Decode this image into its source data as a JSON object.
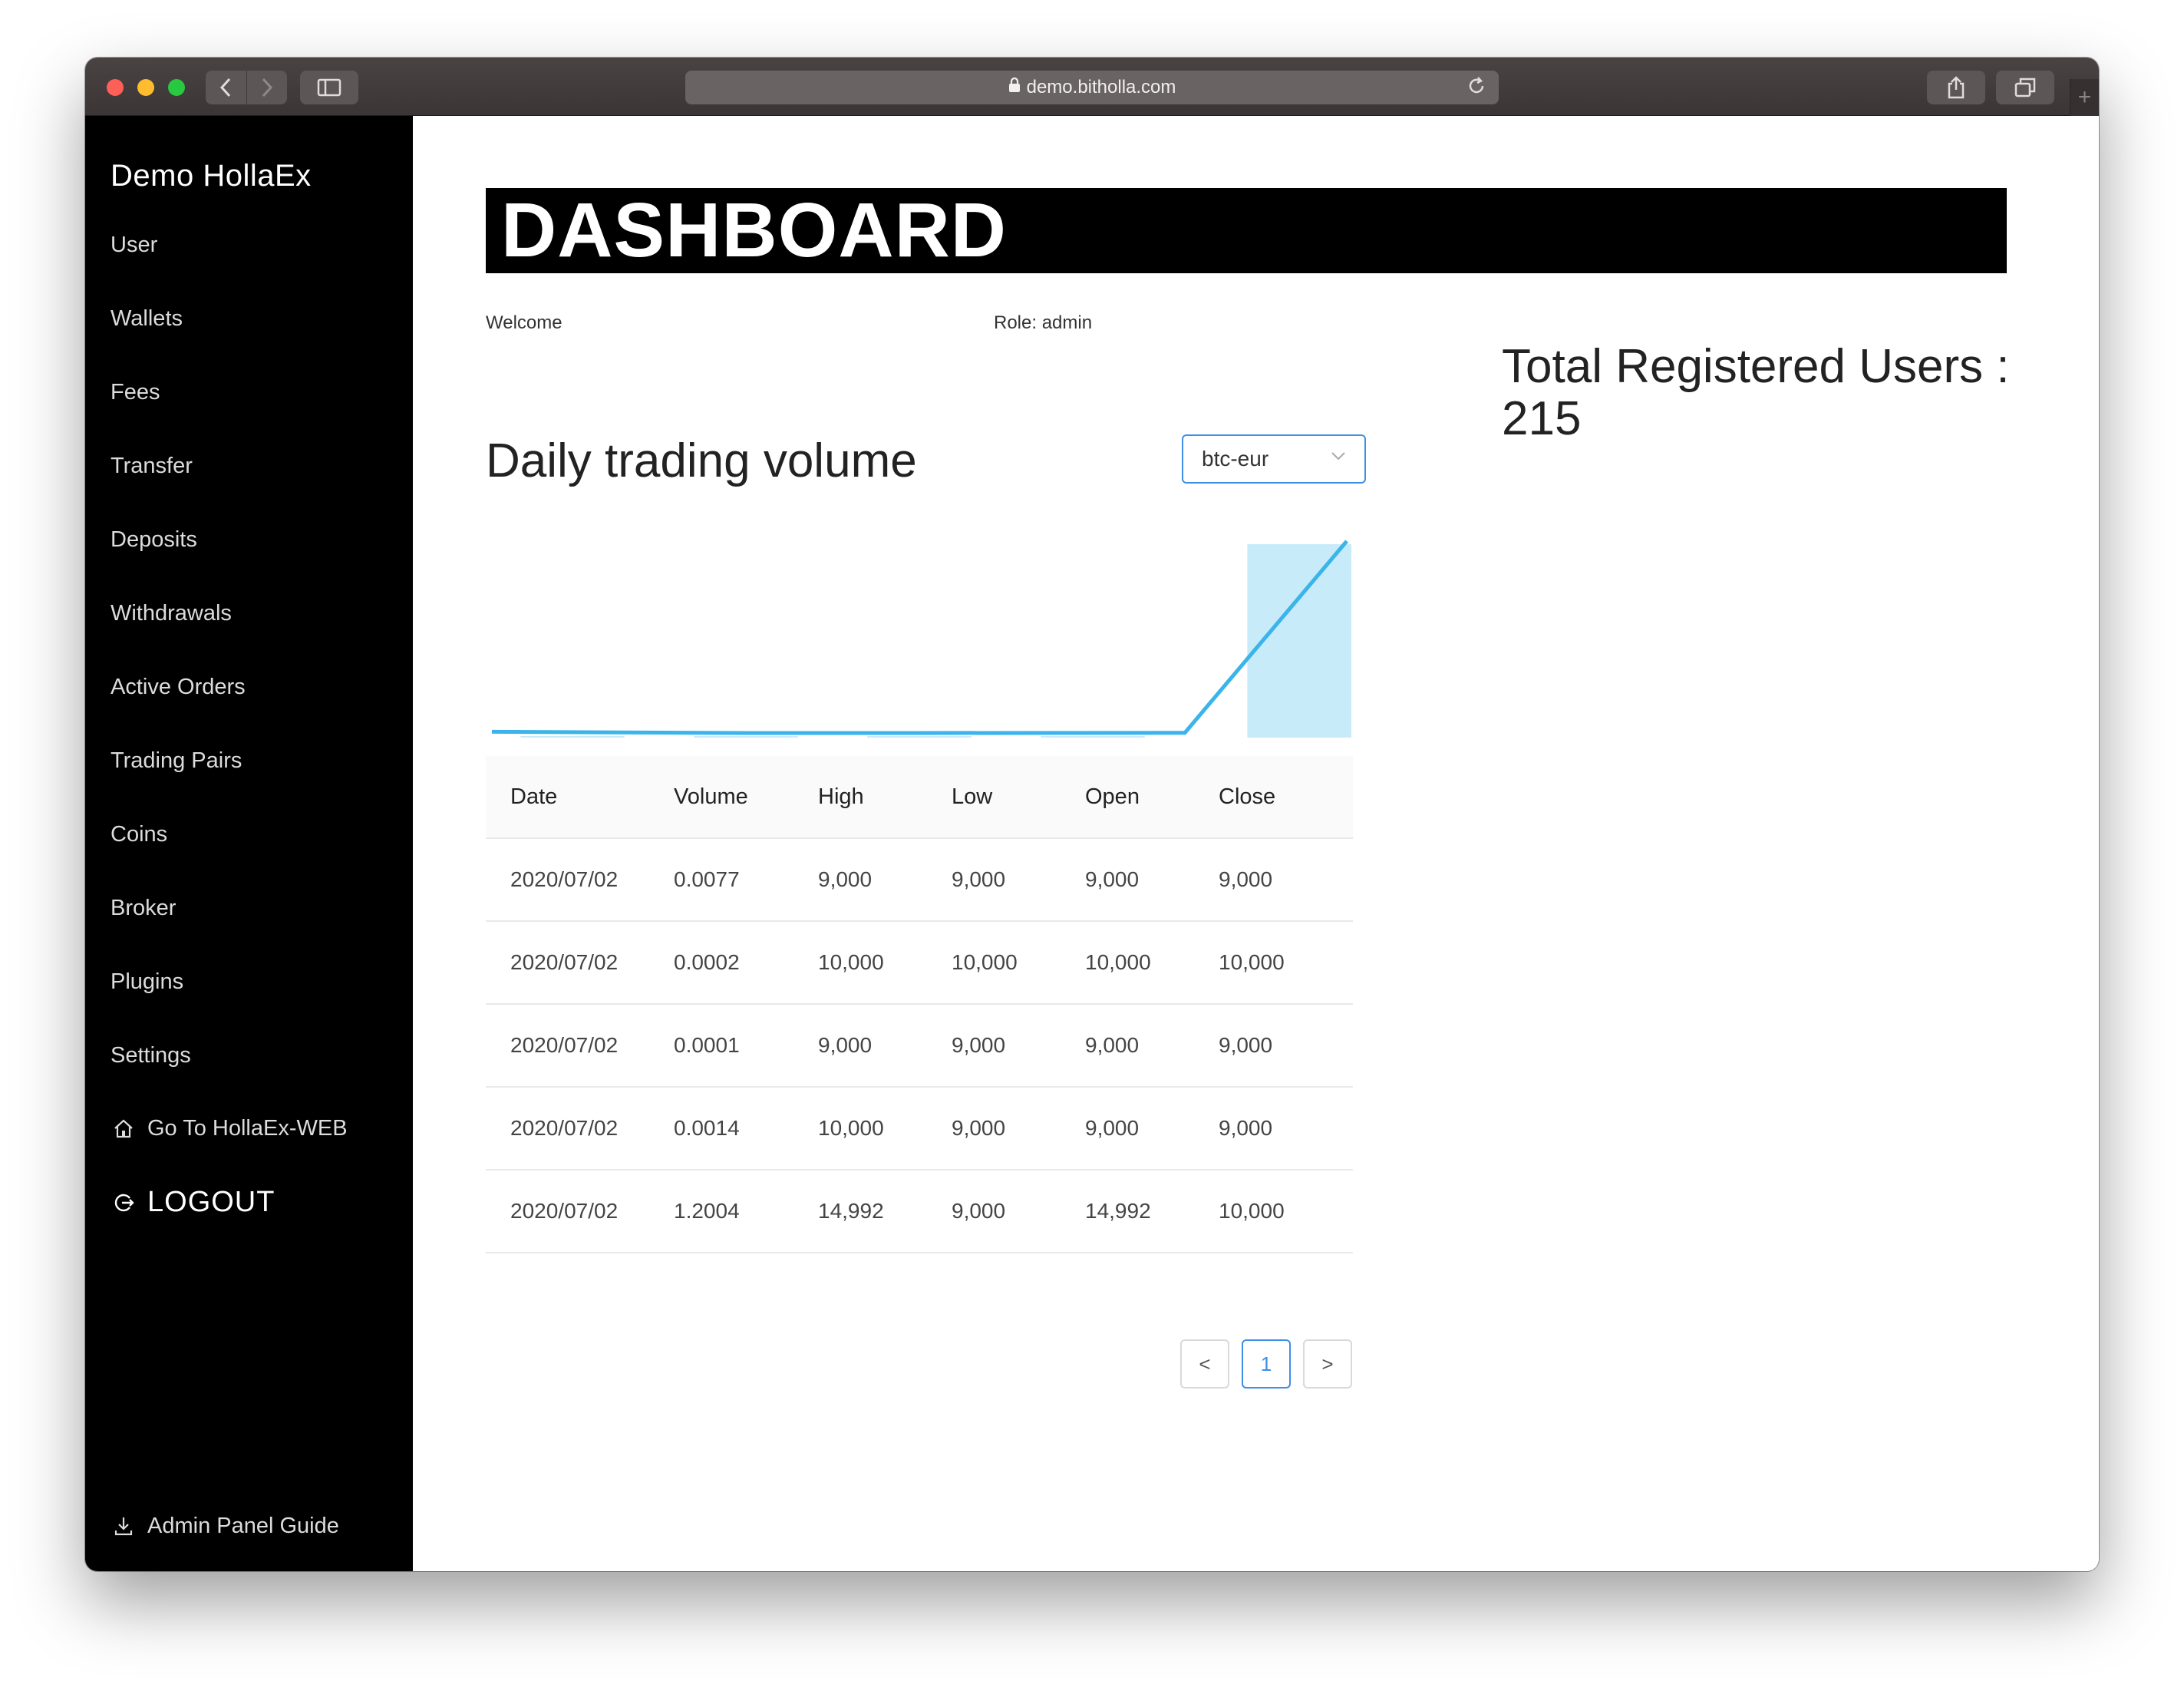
{
  "browser": {
    "url": "demo.bitholla.com"
  },
  "sidebar": {
    "brand": "Demo HollaEx",
    "items": [
      {
        "label": "User"
      },
      {
        "label": "Wallets"
      },
      {
        "label": "Fees"
      },
      {
        "label": "Transfer"
      },
      {
        "label": "Deposits"
      },
      {
        "label": "Withdrawals"
      },
      {
        "label": "Active Orders"
      },
      {
        "label": "Trading Pairs"
      },
      {
        "label": "Coins"
      },
      {
        "label": "Broker"
      },
      {
        "label": "Plugins"
      },
      {
        "label": "Settings"
      }
    ],
    "go_to_web": "Go To HollaEx-WEB",
    "logout": "LOGOUT",
    "guide": "Admin Panel Guide",
    "icons": {
      "home": "home-icon",
      "logout": "logout-icon",
      "download": "download-icon"
    }
  },
  "main": {
    "title": "DASHBOARD",
    "welcome": "Welcome",
    "role": "Role: admin",
    "total_users": "Total Registered Users : 215",
    "chart_title": "Daily trading volume",
    "pair_select": {
      "value": "btc-eur",
      "icon": "chevron-down-icon"
    },
    "colors": {
      "line": "#3ab4ea",
      "bar": "#c8ebfa",
      "select_border": "#3f8ee6"
    }
  },
  "chart_data": {
    "type": "line",
    "series": [
      {
        "values": [
          0.0077,
          0.0002,
          0.0001,
          0.0014,
          1.2004
        ]
      }
    ],
    "bars": [
      0.0077,
      0.0002,
      0.0001,
      0.0014,
      1.2004
    ],
    "grid": false
  },
  "table": {
    "headers": [
      "Date",
      "Volume",
      "High",
      "Low",
      "Open",
      "Close"
    ],
    "rows": [
      [
        "2020/07/02",
        "0.0077",
        "9,000",
        "9,000",
        "9,000",
        "9,000"
      ],
      [
        "2020/07/02",
        "0.0002",
        "10,000",
        "10,000",
        "10,000",
        "10,000"
      ],
      [
        "2020/07/02",
        "0.0001",
        "9,000",
        "9,000",
        "9,000",
        "9,000"
      ],
      [
        "2020/07/02",
        "0.0014",
        "10,000",
        "9,000",
        "9,000",
        "9,000"
      ],
      [
        "2020/07/02",
        "1.2004",
        "14,992",
        "9,000",
        "14,992",
        "10,000"
      ]
    ]
  },
  "pagination": {
    "prev": "<",
    "current": "1",
    "next": ">"
  }
}
